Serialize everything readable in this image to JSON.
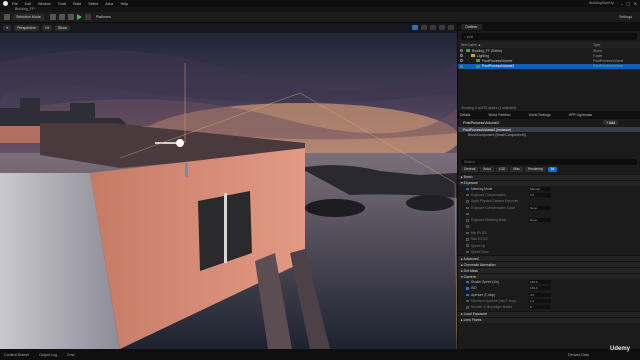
{
  "menubar": {
    "items": [
      "File",
      "Edit",
      "Window",
      "Tools",
      "Build",
      "Select",
      "Actor",
      "Help"
    ],
    "project": "Building_FF*",
    "title": "BuildingStartUp",
    "controls": [
      "–",
      "▢",
      "✕"
    ]
  },
  "toolbar": {
    "mode": "Selection Mode",
    "platforms": "Platforms",
    "settings": "Settings"
  },
  "viewport": {
    "perspective": "Perspective",
    "lit": "Lit",
    "show": "Show"
  },
  "outliner": {
    "tab": "Outliner",
    "search_placeholder": "post",
    "col_label": "Item Label ▲",
    "col_type": "Type",
    "rows": [
      {
        "label": "Building_FF (Editor)",
        "type": "World",
        "indent": 0,
        "kind": "world",
        "selected": false
      },
      {
        "label": "Lighting",
        "type": "Folder",
        "indent": 1,
        "kind": "folder",
        "selected": false
      },
      {
        "label": "PostProcessVolume",
        "type": "PostProcessVolume",
        "indent": 2,
        "kind": "actor",
        "selected": false
      },
      {
        "label": "PostProcessVolume2",
        "type": "PostProcessVolume",
        "indent": 2,
        "kind": "actor",
        "selected": true
      }
    ],
    "footer": "Showing 2 of 870 actors (1 selected)"
  },
  "details": {
    "tabs": [
      "Details",
      "World Partition",
      "World Settings",
      "HPR Lightmass"
    ],
    "actor_name": "PostProcessVolume2",
    "add_label": "+ Add",
    "components": [
      "PostProcessVolume2 (Instance)",
      "BrushComponent (BrushComponent0)"
    ],
    "search_placeholder": "Search",
    "filters": [
      "General",
      "Actor",
      "LOD",
      "Misc",
      "Rendering",
      "All"
    ],
    "sections": {
      "brush": "▸ Brush",
      "exposure": "▾ Exposure",
      "advanced": "▸ Advanced",
      "chromatic": "▸ Chromatic Aberration",
      "dirt": "▸ Dirt Mask",
      "camera": "▾ Camera",
      "local": "▸ Local Exposure",
      "lens": "▸ Lens Flares"
    },
    "exposure_props": [
      {
        "label": "Metering Mode",
        "value": "Manual",
        "on": true
      },
      {
        "label": "Exposure Compensation",
        "value": "0.0",
        "on": false
      },
      {
        "label": "Apply Physical Camera Exposure",
        "value": "",
        "on": false
      },
      {
        "label": "Exposure Compensation Curve",
        "value": "None",
        "on": false
      },
      {
        "label": "",
        "value": "",
        "on": false
      },
      {
        "label": "Exposure Metering Mask",
        "value": "None",
        "on": false
      },
      {
        "label": "",
        "value": "",
        "on": false
      },
      {
        "label": "Min EV100",
        "value": "",
        "on": false
      },
      {
        "label": "Max EV100",
        "value": "",
        "on": false
      },
      {
        "label": "Speed Up",
        "value": "",
        "on": false
      },
      {
        "label": "Speed Down",
        "value": "",
        "on": false
      }
    ],
    "camera_props": [
      {
        "label": "Shutter Speed (1/s)",
        "value": "160.0",
        "on": true
      },
      {
        "label": "ISO",
        "value": "100.0",
        "on": true
      },
      {
        "label": "Aperture (F-stop)",
        "value": "4.0",
        "on": true
      },
      {
        "label": "Maximum Aperture (min F-stop)",
        "value": "1.2",
        "on": false
      },
      {
        "label": "Number of diaphragm blades",
        "value": "5",
        "on": false
      }
    ]
  },
  "status": {
    "items": [
      "Content Drawer",
      "Output Log",
      "Cmd"
    ],
    "right": [
      "Derived Data",
      "Source Control"
    ],
    "brand": "Udemy"
  },
  "colors": {
    "accent": "#0e5fb5",
    "sky_top": "#1b2336",
    "sunset": "#e39a62",
    "wall": "#d68872",
    "sea": "#2b3546"
  }
}
